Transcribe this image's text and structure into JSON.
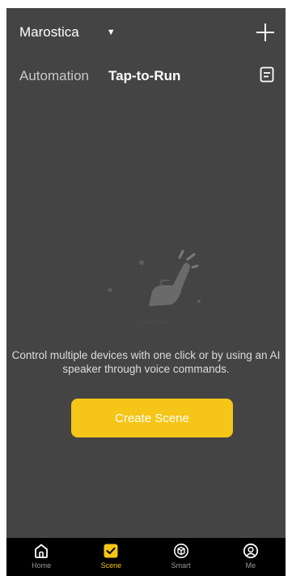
{
  "header": {
    "home_name": "Marostica",
    "tabs": [
      {
        "label": "Automation",
        "active": false
      },
      {
        "label": "Tap-to-Run",
        "active": true
      }
    ]
  },
  "main": {
    "empty_message": "Control multiple devices with one click or by using an AI speaker through voice commands.",
    "create_button_label": "Create Scene"
  },
  "tabbar": {
    "items": [
      {
        "label": "Home",
        "icon": "home-icon",
        "active": false
      },
      {
        "label": "Scene",
        "icon": "scene-check-icon",
        "active": true
      },
      {
        "label": "Smart",
        "icon": "smart-cube-icon",
        "active": false
      },
      {
        "label": "Me",
        "icon": "profile-icon",
        "active": false
      }
    ]
  },
  "colors": {
    "background": "#444444",
    "accent": "#f5c518",
    "tabbar_background": "#000000"
  }
}
